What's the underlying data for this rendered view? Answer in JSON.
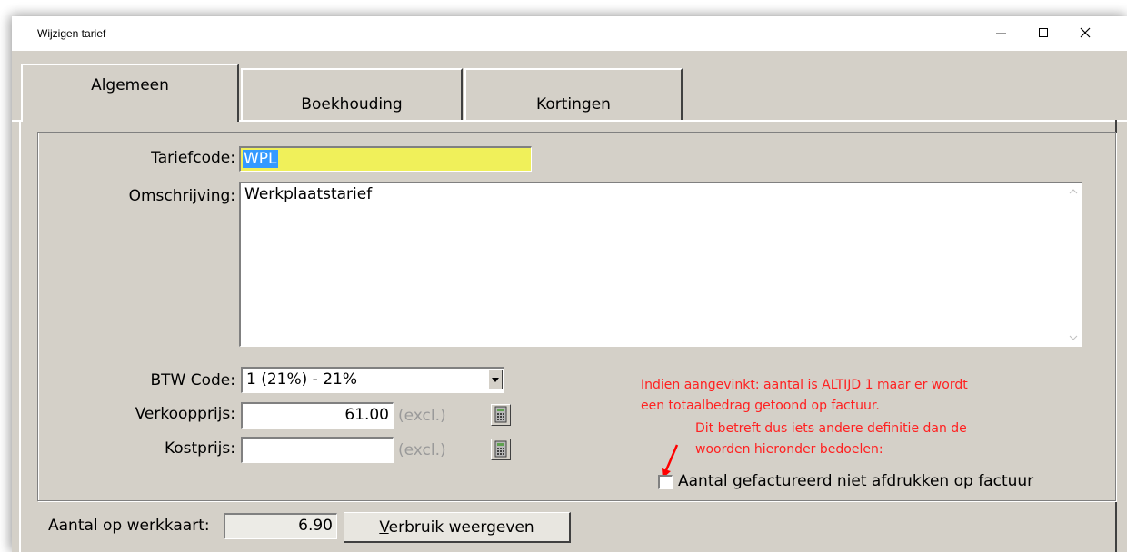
{
  "window": {
    "title": "Wijzigen tarief",
    "controls": [
      "minimize-icon",
      "maximize-icon",
      "close-icon"
    ]
  },
  "tabs": [
    {
      "label": "Algemeen",
      "active": true
    },
    {
      "label": "Boekhouding",
      "active": false
    },
    {
      "label": "Kortingen",
      "active": false
    }
  ],
  "form": {
    "tariefcode_label": "Tariefcode:",
    "tariefcode_value": "WPL",
    "omschrijving_label": "Omschrijving:",
    "omschrijving_value": "Werkplaatstarief",
    "btw_label": "BTW Code:",
    "btw_value": "1 (21%) - 21%",
    "verkoopprijs_label": "Verkoopprijs:",
    "verkoopprijs_value": "61.00",
    "kostprijs_label": "Kostprijs:",
    "kostprijs_value": "",
    "excl_label": "(excl.)"
  },
  "annotation": {
    "line1": "Indien aangevinkt: aantal is ALTIJD 1 maar er wordt",
    "line2": "een totaalbedrag getoond op factuur.",
    "line3": "Dit betreft dus iets andere definitie dan de",
    "line4": "woorden hieronder bedoelen:",
    "color": "#ff2020"
  },
  "checkbox": {
    "label": "Aantal gefactureerd niet afdrukken op factuur",
    "checked": false
  },
  "footer": {
    "werkkaart_label": "Aantal op werkkaart:",
    "werkkaart_value": "6.90",
    "verbruik_button": "Verbruik weergeven"
  },
  "colors": {
    "tariefcode_bg": "#f0f05a",
    "window_bg": "#d4d0c8",
    "selection": "#3399ff"
  }
}
